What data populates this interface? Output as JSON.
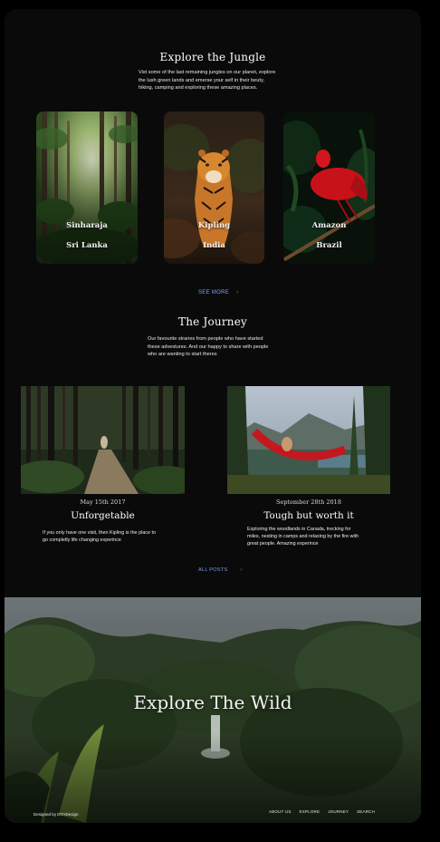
{
  "jungle": {
    "title": "Explore the Jungle",
    "intro_lines": [
      "Vist some of the last remaining jungles on our planet, explore",
      "the lush green lands and emerse your self in their beuty,",
      "hiking, camping and exploring these amazing places."
    ],
    "cards": [
      {
        "name": "Sinharaja",
        "country": "Sri Lanka"
      },
      {
        "name": "Kipling",
        "country": "India"
      },
      {
        "name": "Amazon",
        "country": "Brazil"
      }
    ],
    "see_more": "SEE MORE",
    "see_more_arrow": "›"
  },
  "journey": {
    "title": "The Journey",
    "intro_lines": [
      "Our favourite straries from people who have started",
      "these advestures. And our happy to share with people",
      "who are wanting to start theres"
    ],
    "posts": [
      {
        "date": "May 15th 2017",
        "title": "Unforgetable",
        "excerpt_lines": [
          "If you only have one visit, then Kipling is the place to",
          "go completly life changing experince"
        ]
      },
      {
        "date": "September 28th 2018",
        "title": "Tough but worth it",
        "excerpt_lines": [
          "Exploring the woodlands in Canada, trecking for",
          "miles, nesting in camps and relaxing by the fire with",
          "great people. Amazing experince"
        ]
      }
    ],
    "all_posts": "ALL POSTS",
    "all_posts_arrow": "›"
  },
  "hero": {
    "title": "Explore The Wild"
  },
  "footer": {
    "credit": "Designed by DTHDesign",
    "nav": [
      "ABOUT US",
      "EXPLORE",
      "JOURNEY",
      "SEARCH"
    ]
  },
  "colors": {
    "page_bg": "#0a0a0b",
    "link": "#7ea2e8"
  }
}
